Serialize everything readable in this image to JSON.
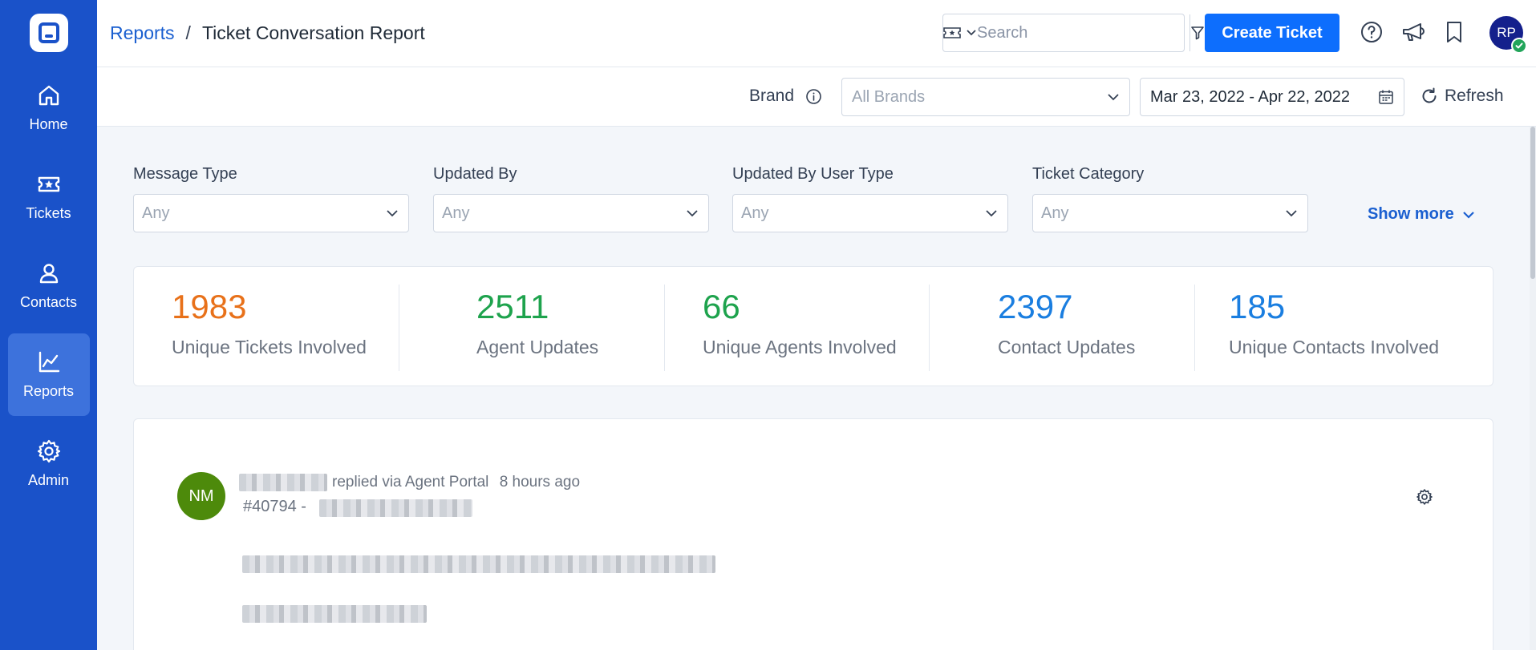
{
  "sidebar": {
    "items": [
      {
        "label": "Home",
        "icon": "home-icon",
        "active": false
      },
      {
        "label": "Tickets",
        "icon": "ticket-icon",
        "active": false
      },
      {
        "label": "Contacts",
        "icon": "contact-icon",
        "active": false
      },
      {
        "label": "Reports",
        "icon": "reports-icon",
        "active": true
      },
      {
        "label": "Admin",
        "icon": "gear-icon",
        "active": false
      }
    ]
  },
  "header": {
    "breadcrumb_parent": "Reports",
    "breadcrumb_separator": "/",
    "breadcrumb_current": "Ticket Conversation Report",
    "search_placeholder": "Search",
    "create_ticket_label": "Create Ticket",
    "avatar_initials": "RP"
  },
  "filterbar": {
    "brand_label": "Brand",
    "brand_placeholder": "All Brands",
    "date_range": "Mar 23, 2022 - Apr 22, 2022",
    "refresh_label": "Refresh"
  },
  "filters": [
    {
      "label": "Message Type",
      "value": "Any"
    },
    {
      "label": "Updated By",
      "value": "Any"
    },
    {
      "label": "Updated By User Type",
      "value": "Any"
    },
    {
      "label": "Ticket Category",
      "value": "Any"
    }
  ],
  "show_more_label": "Show more",
  "stats": [
    {
      "value": "1983",
      "label": "Unique Tickets Involved",
      "color": "#e8711a"
    },
    {
      "value": "2511",
      "label": "Agent Updates",
      "color": "#1ea34d"
    },
    {
      "value": "66",
      "label": "Unique Agents Involved",
      "color": "#1ea34d"
    },
    {
      "value": "2397",
      "label": "Contact Updates",
      "color": "#1a7ee0"
    },
    {
      "value": "185",
      "label": "Unique Contacts Involved",
      "color": "#1a7ee0"
    }
  ],
  "feed": {
    "avatar_initials": "NM",
    "action_text": "replied via Agent Portal",
    "time_text": "8 hours ago",
    "ticket_number": "#40794 -"
  },
  "colors": {
    "sidebar_bg": "#1a52c9",
    "primary": "#0d6efd",
    "link": "#1a5fd0"
  }
}
